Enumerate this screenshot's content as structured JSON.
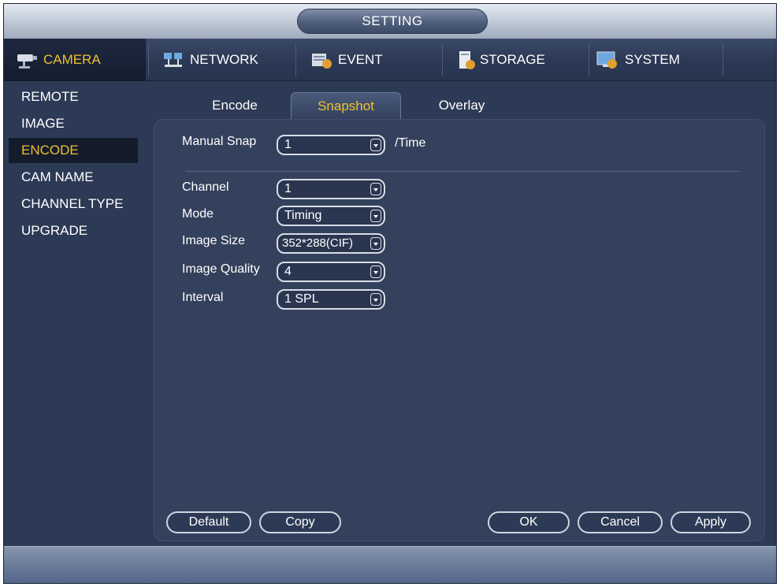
{
  "window": {
    "title": "SETTING"
  },
  "top_menu": [
    {
      "label": "CAMERA",
      "icon": "camera-icon",
      "active": true
    },
    {
      "label": "NETWORK",
      "icon": "network-icon",
      "active": false
    },
    {
      "label": "EVENT",
      "icon": "event-icon",
      "active": false
    },
    {
      "label": "STORAGE",
      "icon": "storage-icon",
      "active": false
    },
    {
      "label": "SYSTEM",
      "icon": "system-icon",
      "active": false
    }
  ],
  "sidebar": [
    {
      "label": "REMOTE",
      "active": false
    },
    {
      "label": "IMAGE",
      "active": false
    },
    {
      "label": "ENCODE",
      "active": true
    },
    {
      "label": "CAM NAME",
      "active": false
    },
    {
      "label": "CHANNEL TYPE",
      "active": false
    },
    {
      "label": "UPGRADE",
      "active": false
    }
  ],
  "tabs": [
    {
      "label": "Encode",
      "active": false
    },
    {
      "label": "Snapshot",
      "active": true
    },
    {
      "label": "Overlay",
      "active": false
    }
  ],
  "form": {
    "manual_snap": {
      "label": "Manual Snap",
      "value": "1",
      "unit": "/Time"
    },
    "channel": {
      "label": "Channel",
      "value": "1"
    },
    "mode": {
      "label": "Mode",
      "value": "Timing"
    },
    "image_size": {
      "label": "Image Size",
      "value": "352*288(CIF)"
    },
    "image_quality": {
      "label": "Image Quality",
      "value": "4"
    },
    "interval": {
      "label": "Interval",
      "value": "1 SPL"
    }
  },
  "buttons": {
    "default": "Default",
    "copy": "Copy",
    "ok": "OK",
    "cancel": "Cancel",
    "apply": "Apply"
  },
  "colors": {
    "active_text": "#f0c030",
    "panel": "#33415c",
    "background": "#2c3a55"
  }
}
